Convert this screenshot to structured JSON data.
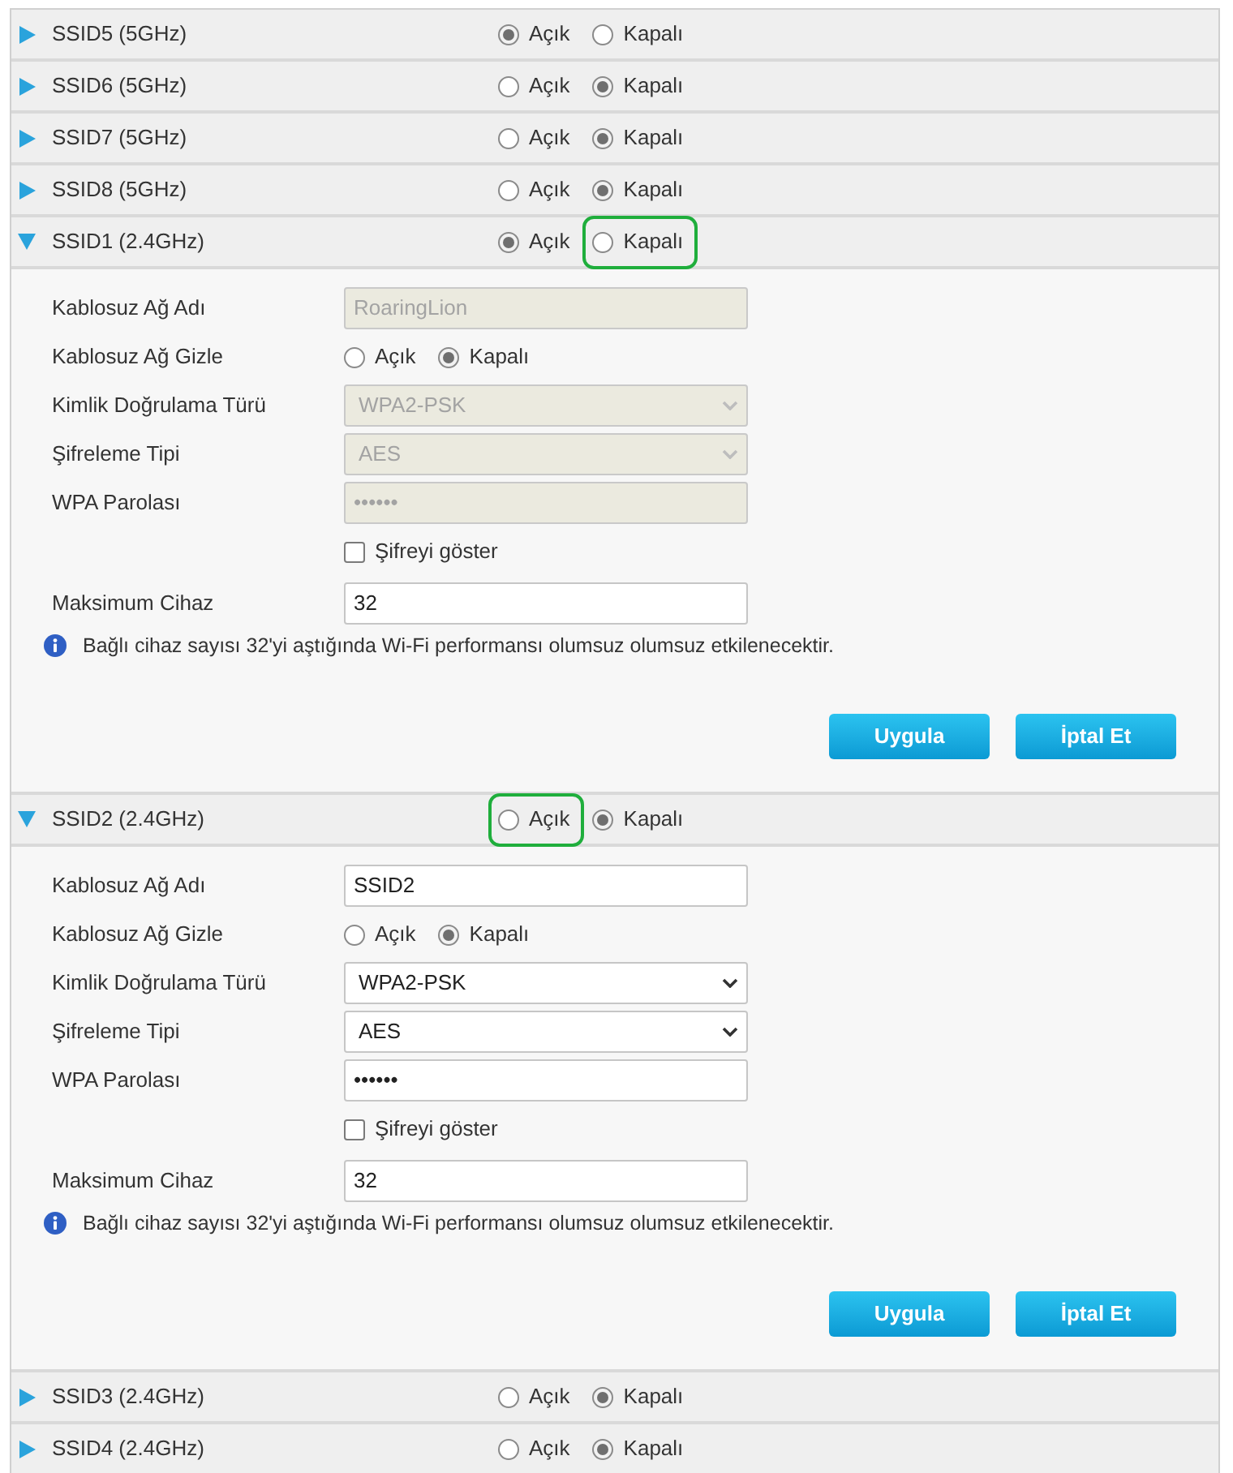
{
  "ssids": [
    {
      "title": "SSID5 (5GHz)",
      "expanded": false,
      "options": [
        {
          "label": "Açık",
          "selected": true,
          "highlighted": false
        },
        {
          "label": "Kapalı",
          "selected": false,
          "highlighted": false
        }
      ]
    },
    {
      "title": "SSID6 (5GHz)",
      "expanded": false,
      "options": [
        {
          "label": "Açık",
          "selected": false,
          "highlighted": false
        },
        {
          "label": "Kapalı",
          "selected": true,
          "highlighted": false
        }
      ]
    },
    {
      "title": "SSID7 (5GHz)",
      "expanded": false,
      "options": [
        {
          "label": "Açık",
          "selected": false,
          "highlighted": false
        },
        {
          "label": "Kapalı",
          "selected": true,
          "highlighted": false
        }
      ]
    },
    {
      "title": "SSID8 (5GHz)",
      "expanded": false,
      "options": [
        {
          "label": "Açık",
          "selected": false,
          "highlighted": false
        },
        {
          "label": "Kapalı",
          "selected": true,
          "highlighted": false
        }
      ]
    },
    {
      "title": "SSID1 (2.4GHz)",
      "expanded": true,
      "options": [
        {
          "label": "Açık",
          "selected": true,
          "highlighted": false
        },
        {
          "label": "Kapalı",
          "selected": false,
          "highlighted": true
        }
      ],
      "settings": {
        "fields": [
          {
            "kind": "text",
            "label": "Kablosuz Ağ Adı",
            "value": "RoaringLion",
            "disabled": true
          },
          {
            "kind": "radio",
            "label": "Kablosuz Ağ Gizle",
            "options": [
              {
                "label": "Açık",
                "selected": false
              },
              {
                "label": "Kapalı",
                "selected": true
              }
            ]
          },
          {
            "kind": "select",
            "label": "Kimlik Doğrulama Türü",
            "value": "WPA2-PSK",
            "disabled": true
          },
          {
            "kind": "select",
            "label": "Şifreleme Tipi",
            "value": "AES",
            "disabled": true
          },
          {
            "kind": "password",
            "label": "WPA Parolası",
            "value": "••••••",
            "disabled": true
          },
          {
            "kind": "checkbox",
            "label": "Şifreyi göster",
            "checked": false
          },
          {
            "kind": "text",
            "label": "Maksimum Cihaz",
            "value": "32",
            "disabled": false
          }
        ],
        "info": "Bağlı cihaz sayısı 32'yi aştığında Wi-Fi performansı olumsuz olumsuz etkilenecektir.",
        "buttons": [
          "Uygula",
          "İptal Et"
        ]
      }
    },
    {
      "title": "SSID2 (2.4GHz)",
      "expanded": true,
      "options": [
        {
          "label": "Açık",
          "selected": false,
          "highlighted": true
        },
        {
          "label": "Kapalı",
          "selected": true,
          "highlighted": false
        }
      ],
      "settings": {
        "fields": [
          {
            "kind": "text",
            "label": "Kablosuz Ağ Adı",
            "value": "SSID2",
            "disabled": false
          },
          {
            "kind": "radio",
            "label": "Kablosuz Ağ Gizle",
            "options": [
              {
                "label": "Açık",
                "selected": false
              },
              {
                "label": "Kapalı",
                "selected": true
              }
            ]
          },
          {
            "kind": "select",
            "label": "Kimlik Doğrulama Türü",
            "value": "WPA2-PSK",
            "disabled": false
          },
          {
            "kind": "select",
            "label": "Şifreleme Tipi",
            "value": "AES",
            "disabled": false
          },
          {
            "kind": "password",
            "label": "WPA Parolası",
            "value": "••••••",
            "disabled": false
          },
          {
            "kind": "checkbox",
            "label": "Şifreyi göster",
            "checked": false
          },
          {
            "kind": "text",
            "label": "Maksimum Cihaz",
            "value": "32",
            "disabled": false
          }
        ],
        "info": "Bağlı cihaz sayısı 32'yi aştığında Wi-Fi performansı olumsuz olumsuz etkilenecektir.",
        "buttons": [
          "Uygula",
          "İptal Et"
        ]
      }
    },
    {
      "title": "SSID3 (2.4GHz)",
      "expanded": false,
      "options": [
        {
          "label": "Açık",
          "selected": false,
          "highlighted": false
        },
        {
          "label": "Kapalı",
          "selected": true,
          "highlighted": false
        }
      ]
    },
    {
      "title": "SSID4 (2.4GHz)",
      "expanded": false,
      "options": [
        {
          "label": "Açık",
          "selected": false,
          "highlighted": false
        },
        {
          "label": "Kapalı",
          "selected": true,
          "highlighted": false
        }
      ]
    }
  ]
}
